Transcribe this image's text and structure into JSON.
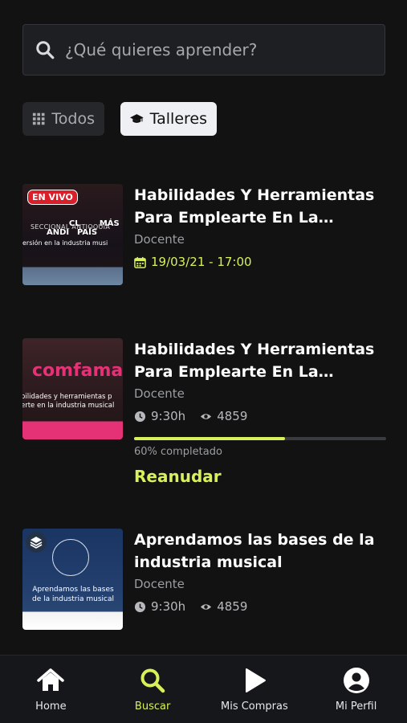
{
  "search": {
    "placeholder": "¿Qué quieres aprender?"
  },
  "filters": [
    {
      "label": "Todos",
      "icon": "grid-icon",
      "selected": false
    },
    {
      "label": "Talleres",
      "icon": "graduation-cap-icon",
      "selected": true
    }
  ],
  "courses": [
    {
      "title": "Habilidades Y Herramientas Para Emplearte En La Industria musical",
      "teacher": "Docente",
      "date": "19/03/21 - 17:00",
      "thumbnail": {
        "badge": "EN VIVO",
        "logo_left": "CL\nANDI",
        "logo_right": "MÁS\nPAÍS",
        "subtitle": "SECCIONAL  ANTIOQUIA",
        "caption": "ersión en la industria musi"
      }
    },
    {
      "title": "Habilidades Y Herramientas Para Emplearte En La Industria musical",
      "teacher": "Docente",
      "duration": "9:30h",
      "views": "4859",
      "progress": 0.6,
      "progress_text": "60% completado",
      "resume_label": "Reanudar",
      "thumbnail": {
        "brand": "comfama",
        "caption": "bilidades y herramientas p\nerte en la industria musical"
      }
    },
    {
      "title": "Aprendamos las bases de la industria musical",
      "teacher": "Docente",
      "duration": "9:30h",
      "views": "4859",
      "thumbnail": {
        "caption": "Aprendamos las bases\nde la industria musical"
      }
    }
  ],
  "nav": [
    {
      "label": "Home",
      "icon": "home-icon",
      "active": false
    },
    {
      "label": "Buscar",
      "icon": "search-icon",
      "active": true
    },
    {
      "label": "Mis Compras",
      "icon": "play-icon",
      "active": false
    },
    {
      "label": "Mi Perfil",
      "icon": "user-icon",
      "active": false
    }
  ],
  "colors": {
    "accent": "#d8f15a",
    "background": "#121212",
    "live": "#d91f2a",
    "brand_pink": "#e53277"
  }
}
